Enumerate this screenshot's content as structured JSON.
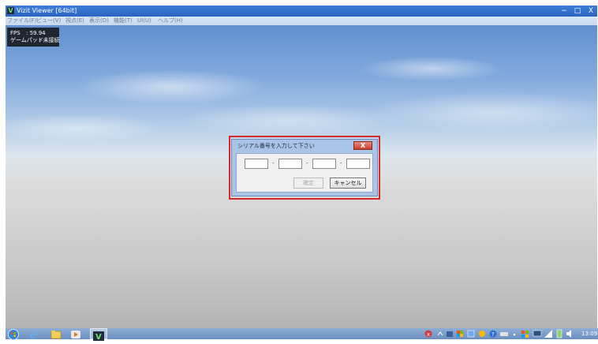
{
  "window": {
    "title": "Vizit Viewer [64bit]",
    "controls": {
      "minimize": "−",
      "maximize": "□",
      "close": "X"
    }
  },
  "menu": [
    "ファイル(F)",
    "ビュー(V)",
    "視点(E)",
    "表示(D)",
    "機能(T)",
    "UI(U)",
    "ヘルプ(H)"
  ],
  "stats": {
    "fps_label": "FPS",
    "fps_value": ": 59.94",
    "gamepad_label": "ゲームパッド",
    "gamepad_value": ": 未接続"
  },
  "dialog": {
    "title": "シリアル番号を入力して下さい",
    "close": "X",
    "separator": "-",
    "fields": [
      "",
      "",
      "",
      ""
    ],
    "ok_label": "確定",
    "cancel_label": "キャンセル"
  },
  "taskbar": {
    "clock": "13:09"
  },
  "colors": {
    "titlebar": "#2b64c0",
    "highlight_border": "#d42a2a",
    "dialog_frame": "#a9c4e6"
  }
}
